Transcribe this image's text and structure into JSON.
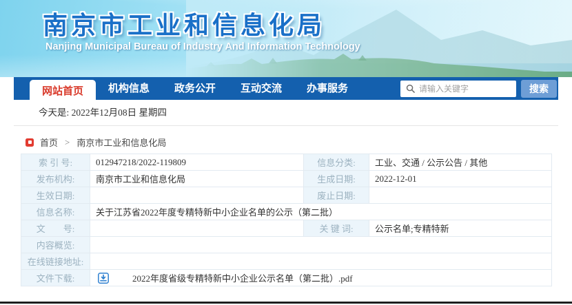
{
  "banner": {
    "title_cn": "南京市工业和信息化局",
    "title_en": "Nanjing Municipal Bureau of Industry And Information Technology"
  },
  "nav": {
    "tabs": [
      {
        "label": "网站首页",
        "active": true
      },
      {
        "label": "机构信息",
        "active": false
      },
      {
        "label": "政务公开",
        "active": false
      },
      {
        "label": "互动交流",
        "active": false
      },
      {
        "label": "办事服务",
        "active": false
      }
    ],
    "search_placeholder": "请输入关键字",
    "search_button": "搜索"
  },
  "date_line": "今天是: 2022年12月08日 星期四",
  "breadcrumb": {
    "home": "首页",
    "separator": ">",
    "current": "南京市工业和信息化局"
  },
  "info_table": {
    "rows": [
      {
        "left_label": "索 引 号:",
        "left_value": "012947218/2022-119809",
        "right_label": "信息分类:",
        "right_value": "工业、交通 / 公示公告 / 其他"
      },
      {
        "left_label": "发布机构:",
        "left_value": "南京市工业和信息化局",
        "right_label": "生成日期:",
        "right_value": "2022-12-01"
      },
      {
        "left_label": "生效日期:",
        "left_value": "",
        "right_label": "废止日期:",
        "right_value": ""
      },
      {
        "label": "信息名称:",
        "value": "关于江苏省2022年度专精特新中小企业名单的公示（第二批）"
      },
      {
        "left_label": "文　　号:",
        "left_value": "",
        "right_label": "关 键 词:",
        "right_value": "公示名单;专精特新"
      },
      {
        "label": "内容概览:",
        "value": ""
      },
      {
        "label": "在线链接地址:",
        "value": ""
      },
      {
        "label": "文件下载:",
        "value": "2022年度省级专精特新中小企业公示名单（第二批）.pdf"
      }
    ]
  },
  "colors": {
    "nav_blue": "#1460ae",
    "active_tab_text": "#d93a2b",
    "search_button_bg": "#6e9ed6",
    "label_bg": "#ecf5fb",
    "label_text": "#9cb2c0",
    "value_text": "#333333",
    "banner_title_blue": "#1a70c8",
    "breadcrumb_marker_red": "#e23c31",
    "download_icon_blue": "#2f80d0"
  }
}
